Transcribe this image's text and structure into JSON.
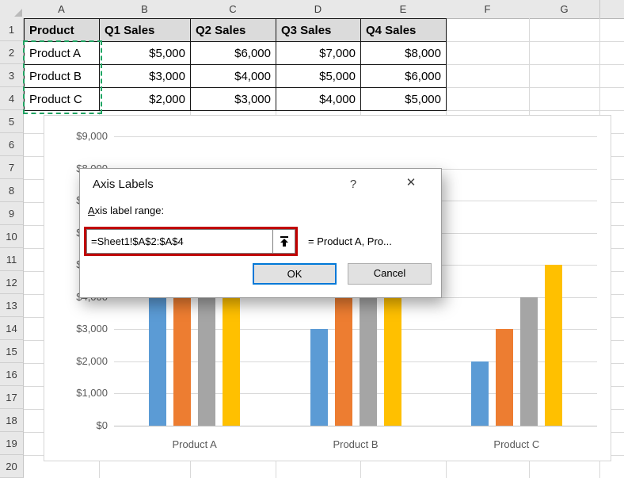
{
  "sheet": {
    "column_headers": [
      "A",
      "B",
      "C",
      "D",
      "E",
      "F",
      "G"
    ],
    "row_headers": [
      "1",
      "2",
      "3",
      "4",
      "5",
      "6",
      "7",
      "8",
      "9",
      "10",
      "11",
      "12",
      "13",
      "14",
      "15",
      "16",
      "17",
      "18",
      "19",
      "20"
    ],
    "table": {
      "headers": [
        "Product",
        "Q1 Sales",
        "Q2 Sales",
        "Q3 Sales",
        "Q4 Sales"
      ],
      "rows": [
        [
          "Product A",
          "$5,000",
          "$6,000",
          "$7,000",
          "$8,000"
        ],
        [
          "Product B",
          "$3,000",
          "$4,000",
          "$5,000",
          "$6,000"
        ],
        [
          "Product C",
          "$2,000",
          "$3,000",
          "$4,000",
          "$5,000"
        ]
      ]
    },
    "selected_range": "A2:A4",
    "selection_color": "#1FA362"
  },
  "chart_data": {
    "type": "bar",
    "title": "",
    "categories": [
      "Product A",
      "Product B",
      "Product C"
    ],
    "series": [
      {
        "name": "Q1 Sales",
        "values": [
          5000,
          3000,
          2000
        ],
        "color": "#5B9BD5"
      },
      {
        "name": "Q2 Sales",
        "values": [
          6000,
          4000,
          3000
        ],
        "color": "#ED7D31"
      },
      {
        "name": "Q3 Sales",
        "values": [
          7000,
          5000,
          4000
        ],
        "color": "#A5A5A5"
      },
      {
        "name": "Q4 Sales",
        "values": [
          8000,
          6000,
          5000
        ],
        "color": "#FFC000"
      }
    ],
    "ylim": [
      0,
      9000
    ],
    "ytick_step": 1000,
    "ytick_labels": [
      "$0",
      "$1,000",
      "$2,000",
      "$3,000",
      "$4,000",
      "$5,000",
      "$6,000",
      "$7,000",
      "$8,000",
      "$9,000"
    ],
    "grid": true,
    "legend": "none"
  },
  "dialog": {
    "title": "Axis Labels",
    "help": "?",
    "close": "✕",
    "field_label": "Axis label range:",
    "field_value": "=Sheet1!$A$2:$A$4",
    "preview": "= Product A, Pro...",
    "ok": "OK",
    "cancel": "Cancel",
    "highlight_color": "#C00000"
  }
}
